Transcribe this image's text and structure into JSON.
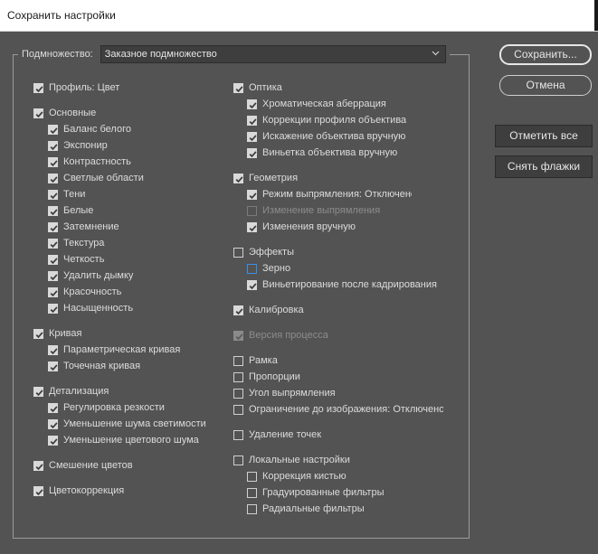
{
  "window": {
    "title": "Сохранить настройки"
  },
  "subset": {
    "label": "Подмножество:",
    "value": "Заказное подмножество"
  },
  "buttons": {
    "save": "Сохранить...",
    "cancel": "Отмена",
    "check_all": "Отметить все",
    "uncheck_all": "Снять флажки"
  },
  "left": {
    "profile": "Профиль: Цвет",
    "basic": "Основные",
    "basic_items": [
      "Баланс белого",
      "Экспонир",
      "Контрастность",
      "Светлые области",
      "Тени",
      "Белые",
      "Затемнение",
      "Текстура",
      "Четкость",
      "Удалить дымку",
      "Красочность",
      "Насыщенность"
    ],
    "curve": "Кривая",
    "curve_items": [
      "Параметрическая кривая",
      "Точечная кривая"
    ],
    "detail": "Детализация",
    "detail_items": [
      "Регулировка резкости",
      "Уменьшение шума светимости",
      "Уменьшение цветового шума"
    ],
    "color_mix": "Смешение цветов",
    "color_grading": "Цветокоррекция"
  },
  "right": {
    "optics": "Оптика",
    "optics_items": [
      "Хроматическая аберрация",
      "Коррекции профиля объектива",
      "Искажение объектива вручную",
      "Виньетка объектива вручную"
    ],
    "geometry": "Геометрия",
    "geometry_items": [
      "Режим выпрямления: Отключено",
      "Изменение выпрямления",
      "Изменения вручную"
    ],
    "effects": "Эффекты",
    "effects_items": [
      "Зерно",
      "Виньетирование после кадрирования"
    ],
    "calibration": "Калибровка",
    "process_version": "Версия процесса",
    "frame": "Рамка",
    "proportions": "Пропорции",
    "straighten_angle": "Угол выпрямления",
    "crop_limit": "Ограничение до изображения: Отключено",
    "spot_removal": "Удаление точек",
    "local": "Локальные настройки",
    "local_items": [
      "Коррекция кистью",
      "Градуированные фильтры",
      "Радиальные фильтры"
    ]
  }
}
